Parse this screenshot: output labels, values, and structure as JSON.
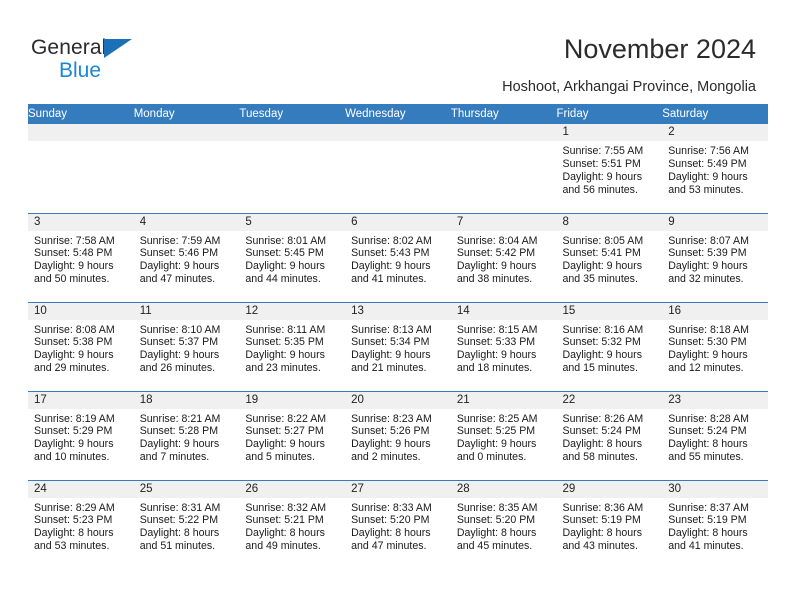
{
  "brand": {
    "name_line1": "General",
    "name_line2": "Blue",
    "triangle_color": "#1b70b8",
    "blue_color": "#1b86d8"
  },
  "header": {
    "title": "November 2024",
    "subtitle": "Hoshoot, Arkhangai Province, Mongolia",
    "accent_color": "#357cbf",
    "daynum_band_color": "#f0f0f0"
  },
  "calendar": {
    "weekday_headers": [
      "Sunday",
      "Monday",
      "Tuesday",
      "Wednesday",
      "Thursday",
      "Friday",
      "Saturday"
    ],
    "labels": {
      "sunrise": "Sunrise:",
      "sunset": "Sunset:",
      "daylight": "Daylight:"
    },
    "weeks": [
      [
        {
          "day": "",
          "empty": true
        },
        {
          "day": "",
          "empty": true
        },
        {
          "day": "",
          "empty": true
        },
        {
          "day": "",
          "empty": true
        },
        {
          "day": "",
          "empty": true
        },
        {
          "day": "1",
          "sunrise": "Sunrise: 7:55 AM",
          "sunset": "Sunset: 5:51 PM",
          "daylight_l1": "Daylight: 9 hours",
          "daylight_l2": "and 56 minutes."
        },
        {
          "day": "2",
          "sunrise": "Sunrise: 7:56 AM",
          "sunset": "Sunset: 5:49 PM",
          "daylight_l1": "Daylight: 9 hours",
          "daylight_l2": "and 53 minutes."
        }
      ],
      [
        {
          "day": "3",
          "sunrise": "Sunrise: 7:58 AM",
          "sunset": "Sunset: 5:48 PM",
          "daylight_l1": "Daylight: 9 hours",
          "daylight_l2": "and 50 minutes."
        },
        {
          "day": "4",
          "sunrise": "Sunrise: 7:59 AM",
          "sunset": "Sunset: 5:46 PM",
          "daylight_l1": "Daylight: 9 hours",
          "daylight_l2": "and 47 minutes."
        },
        {
          "day": "5",
          "sunrise": "Sunrise: 8:01 AM",
          "sunset": "Sunset: 5:45 PM",
          "daylight_l1": "Daylight: 9 hours",
          "daylight_l2": "and 44 minutes."
        },
        {
          "day": "6",
          "sunrise": "Sunrise: 8:02 AM",
          "sunset": "Sunset: 5:43 PM",
          "daylight_l1": "Daylight: 9 hours",
          "daylight_l2": "and 41 minutes."
        },
        {
          "day": "7",
          "sunrise": "Sunrise: 8:04 AM",
          "sunset": "Sunset: 5:42 PM",
          "daylight_l1": "Daylight: 9 hours",
          "daylight_l2": "and 38 minutes."
        },
        {
          "day": "8",
          "sunrise": "Sunrise: 8:05 AM",
          "sunset": "Sunset: 5:41 PM",
          "daylight_l1": "Daylight: 9 hours",
          "daylight_l2": "and 35 minutes."
        },
        {
          "day": "9",
          "sunrise": "Sunrise: 8:07 AM",
          "sunset": "Sunset: 5:39 PM",
          "daylight_l1": "Daylight: 9 hours",
          "daylight_l2": "and 32 minutes."
        }
      ],
      [
        {
          "day": "10",
          "sunrise": "Sunrise: 8:08 AM",
          "sunset": "Sunset: 5:38 PM",
          "daylight_l1": "Daylight: 9 hours",
          "daylight_l2": "and 29 minutes."
        },
        {
          "day": "11",
          "sunrise": "Sunrise: 8:10 AM",
          "sunset": "Sunset: 5:37 PM",
          "daylight_l1": "Daylight: 9 hours",
          "daylight_l2": "and 26 minutes."
        },
        {
          "day": "12",
          "sunrise": "Sunrise: 8:11 AM",
          "sunset": "Sunset: 5:35 PM",
          "daylight_l1": "Daylight: 9 hours",
          "daylight_l2": "and 23 minutes."
        },
        {
          "day": "13",
          "sunrise": "Sunrise: 8:13 AM",
          "sunset": "Sunset: 5:34 PM",
          "daylight_l1": "Daylight: 9 hours",
          "daylight_l2": "and 21 minutes."
        },
        {
          "day": "14",
          "sunrise": "Sunrise: 8:15 AM",
          "sunset": "Sunset: 5:33 PM",
          "daylight_l1": "Daylight: 9 hours",
          "daylight_l2": "and 18 minutes."
        },
        {
          "day": "15",
          "sunrise": "Sunrise: 8:16 AM",
          "sunset": "Sunset: 5:32 PM",
          "daylight_l1": "Daylight: 9 hours",
          "daylight_l2": "and 15 minutes."
        },
        {
          "day": "16",
          "sunrise": "Sunrise: 8:18 AM",
          "sunset": "Sunset: 5:30 PM",
          "daylight_l1": "Daylight: 9 hours",
          "daylight_l2": "and 12 minutes."
        }
      ],
      [
        {
          "day": "17",
          "sunrise": "Sunrise: 8:19 AM",
          "sunset": "Sunset: 5:29 PM",
          "daylight_l1": "Daylight: 9 hours",
          "daylight_l2": "and 10 minutes."
        },
        {
          "day": "18",
          "sunrise": "Sunrise: 8:21 AM",
          "sunset": "Sunset: 5:28 PM",
          "daylight_l1": "Daylight: 9 hours",
          "daylight_l2": "and 7 minutes."
        },
        {
          "day": "19",
          "sunrise": "Sunrise: 8:22 AM",
          "sunset": "Sunset: 5:27 PM",
          "daylight_l1": "Daylight: 9 hours",
          "daylight_l2": "and 5 minutes."
        },
        {
          "day": "20",
          "sunrise": "Sunrise: 8:23 AM",
          "sunset": "Sunset: 5:26 PM",
          "daylight_l1": "Daylight: 9 hours",
          "daylight_l2": "and 2 minutes."
        },
        {
          "day": "21",
          "sunrise": "Sunrise: 8:25 AM",
          "sunset": "Sunset: 5:25 PM",
          "daylight_l1": "Daylight: 9 hours",
          "daylight_l2": "and 0 minutes."
        },
        {
          "day": "22",
          "sunrise": "Sunrise: 8:26 AM",
          "sunset": "Sunset: 5:24 PM",
          "daylight_l1": "Daylight: 8 hours",
          "daylight_l2": "and 58 minutes."
        },
        {
          "day": "23",
          "sunrise": "Sunrise: 8:28 AM",
          "sunset": "Sunset: 5:24 PM",
          "daylight_l1": "Daylight: 8 hours",
          "daylight_l2": "and 55 minutes."
        }
      ],
      [
        {
          "day": "24",
          "sunrise": "Sunrise: 8:29 AM",
          "sunset": "Sunset: 5:23 PM",
          "daylight_l1": "Daylight: 8 hours",
          "daylight_l2": "and 53 minutes."
        },
        {
          "day": "25",
          "sunrise": "Sunrise: 8:31 AM",
          "sunset": "Sunset: 5:22 PM",
          "daylight_l1": "Daylight: 8 hours",
          "daylight_l2": "and 51 minutes."
        },
        {
          "day": "26",
          "sunrise": "Sunrise: 8:32 AM",
          "sunset": "Sunset: 5:21 PM",
          "daylight_l1": "Daylight: 8 hours",
          "daylight_l2": "and 49 minutes."
        },
        {
          "day": "27",
          "sunrise": "Sunrise: 8:33 AM",
          "sunset": "Sunset: 5:20 PM",
          "daylight_l1": "Daylight: 8 hours",
          "daylight_l2": "and 47 minutes."
        },
        {
          "day": "28",
          "sunrise": "Sunrise: 8:35 AM",
          "sunset": "Sunset: 5:20 PM",
          "daylight_l1": "Daylight: 8 hours",
          "daylight_l2": "and 45 minutes."
        },
        {
          "day": "29",
          "sunrise": "Sunrise: 8:36 AM",
          "sunset": "Sunset: 5:19 PM",
          "daylight_l1": "Daylight: 8 hours",
          "daylight_l2": "and 43 minutes."
        },
        {
          "day": "30",
          "sunrise": "Sunrise: 8:37 AM",
          "sunset": "Sunset: 5:19 PM",
          "daylight_l1": "Daylight: 8 hours",
          "daylight_l2": "and 41 minutes."
        }
      ]
    ]
  }
}
